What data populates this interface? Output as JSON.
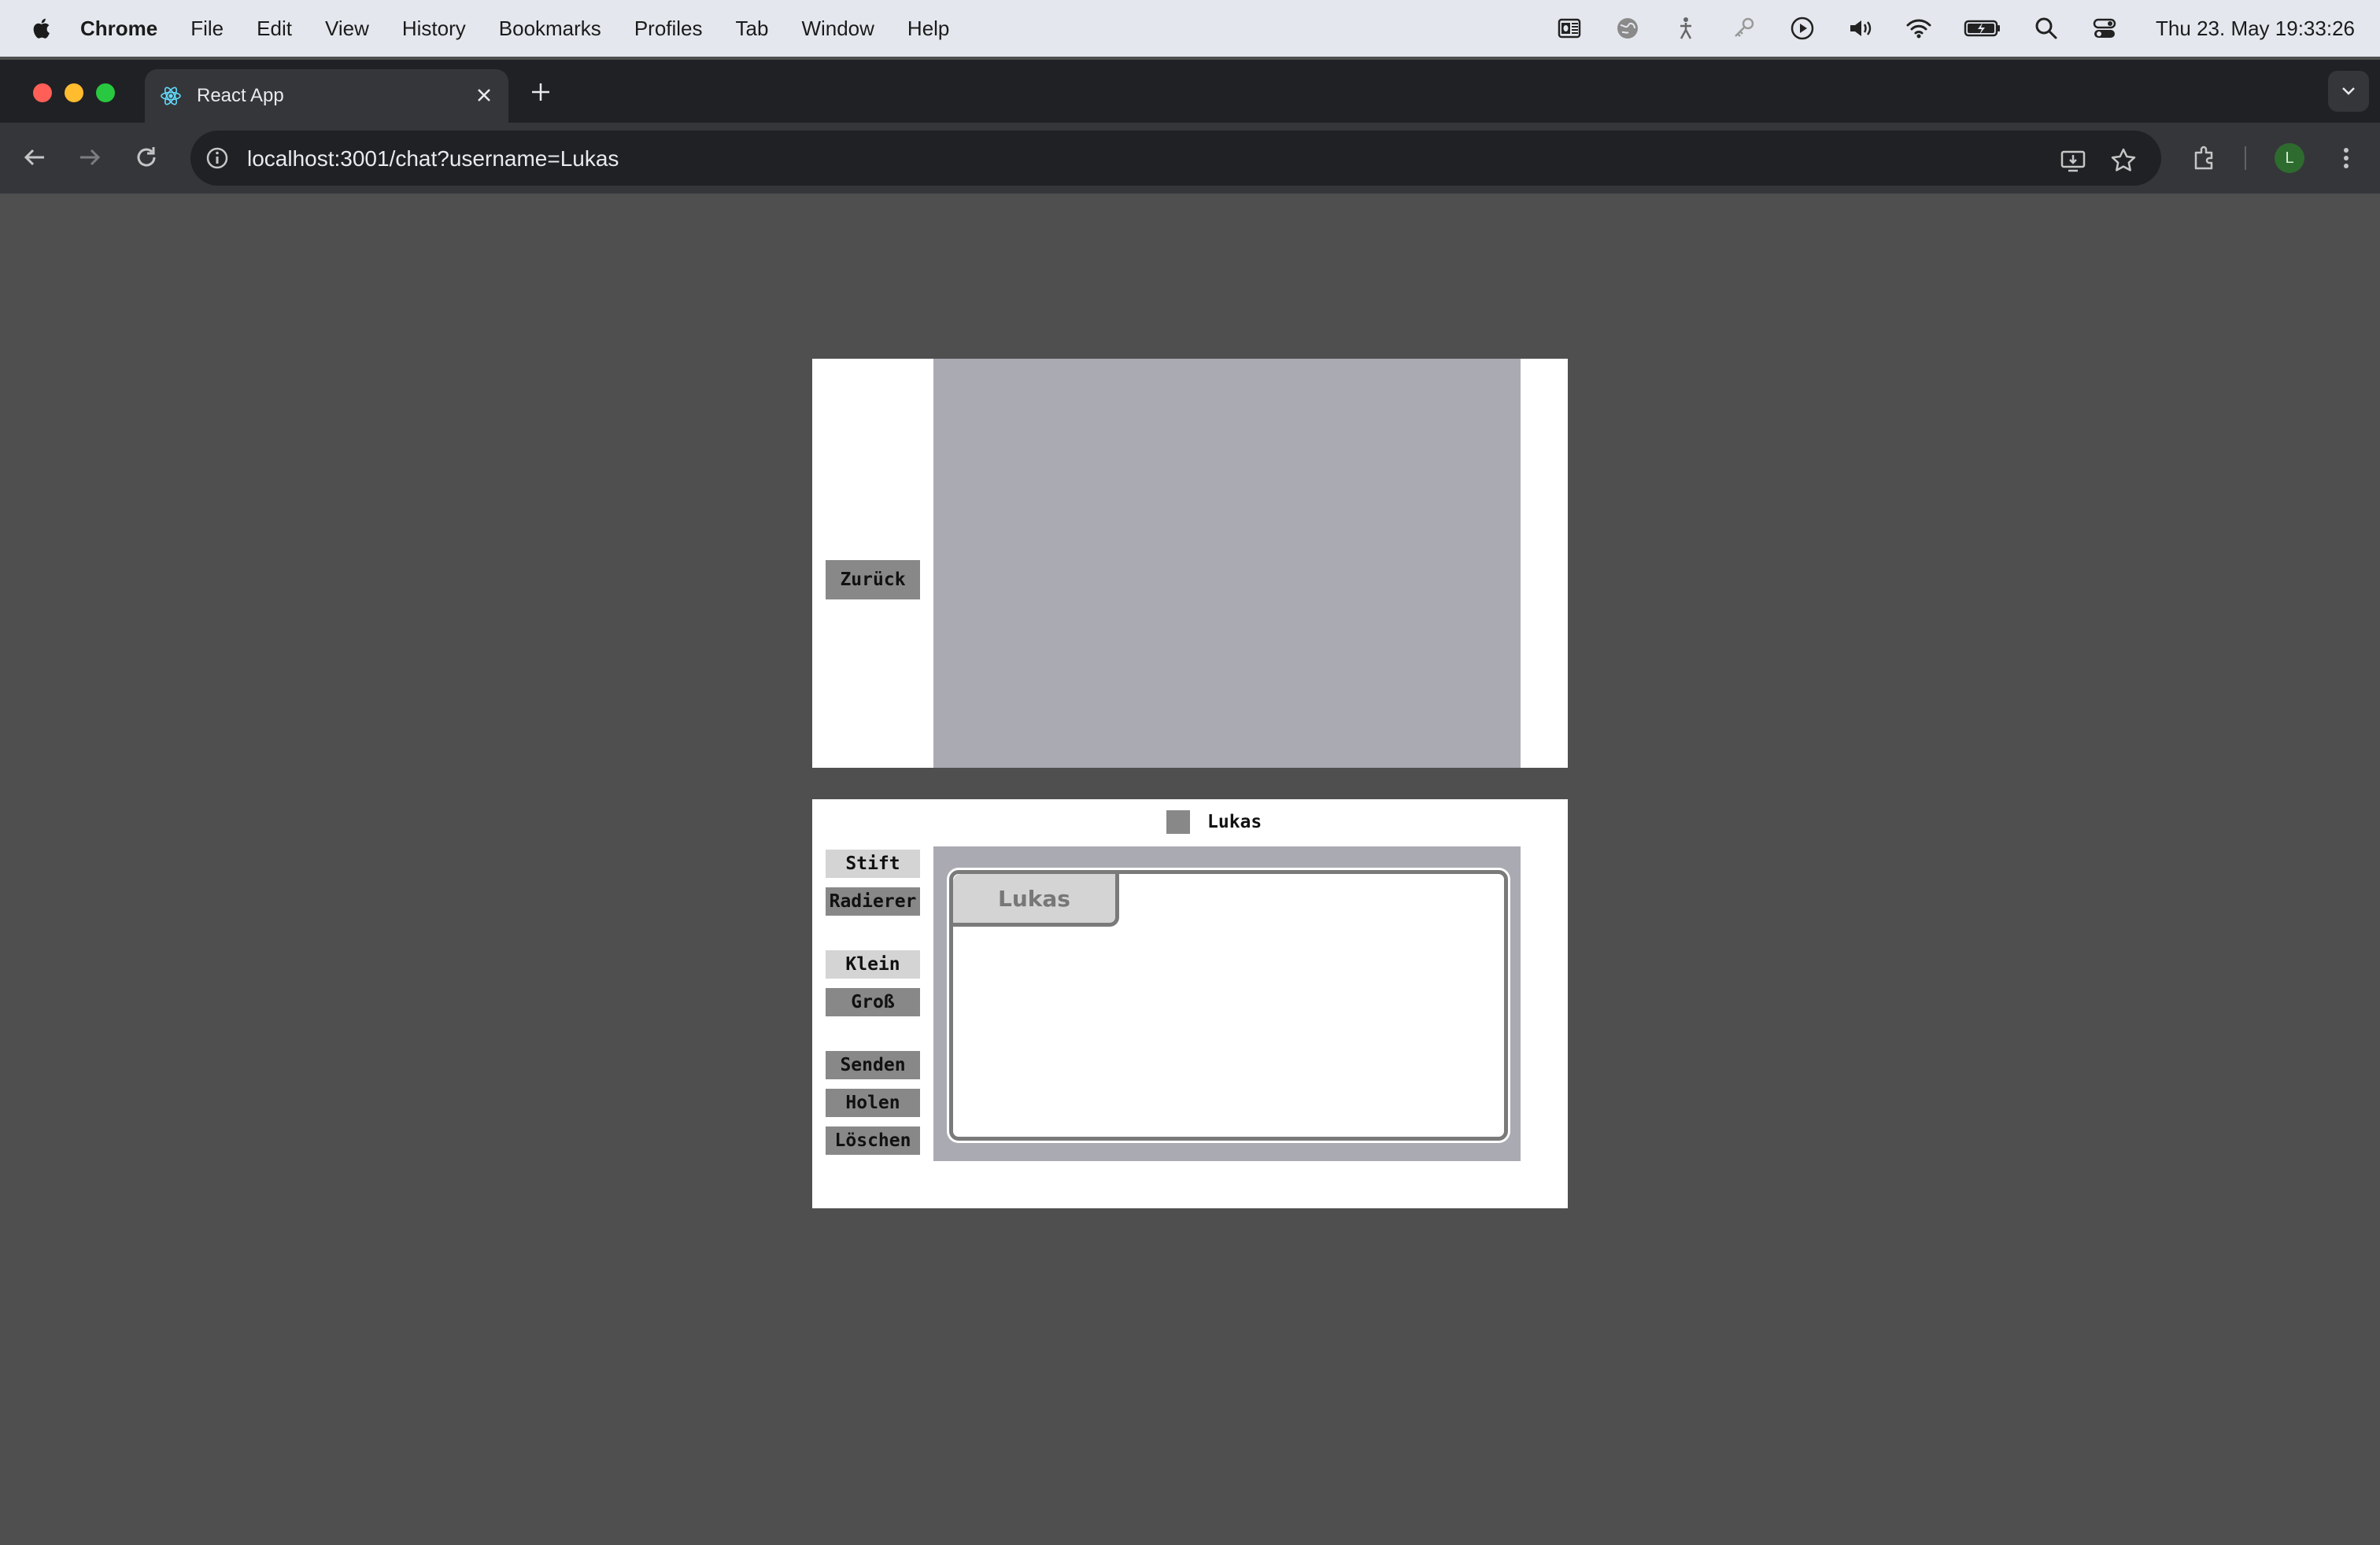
{
  "menubar": {
    "app_name": "Chrome",
    "items": [
      "File",
      "Edit",
      "View",
      "History",
      "Bookmarks",
      "Profiles",
      "Tab",
      "Window",
      "Help"
    ],
    "clock": "Thu 23. May  19:33:26",
    "status_icons": [
      "outlook-icon",
      "globe-icon",
      "accessibility-icon",
      "key-icon",
      "play-icon",
      "volume-icon",
      "wifi-icon",
      "battery-icon",
      "spotlight-icon",
      "control-center-icon"
    ]
  },
  "browser": {
    "tab_title": "React App",
    "url": "localhost:3001/chat?username=Lukas",
    "profile_initial": "L"
  },
  "colors": {
    "page_background": "#4f4f4f",
    "canvas": "#aaaab2",
    "dark_button": "#888888",
    "light_button": "#d4d4d4",
    "user_color": "#888888"
  },
  "top_panel": {
    "back_button": "Zurück"
  },
  "bottom_panel": {
    "username": "Lukas",
    "tools": {
      "pen": "Stift",
      "eraser": "Radierer"
    },
    "sizes": {
      "small": "Klein",
      "large": "Groß"
    },
    "actions": {
      "send": "Senden",
      "fetch": "Holen",
      "delete": "Löschen"
    },
    "pad_owner": "Lukas"
  }
}
